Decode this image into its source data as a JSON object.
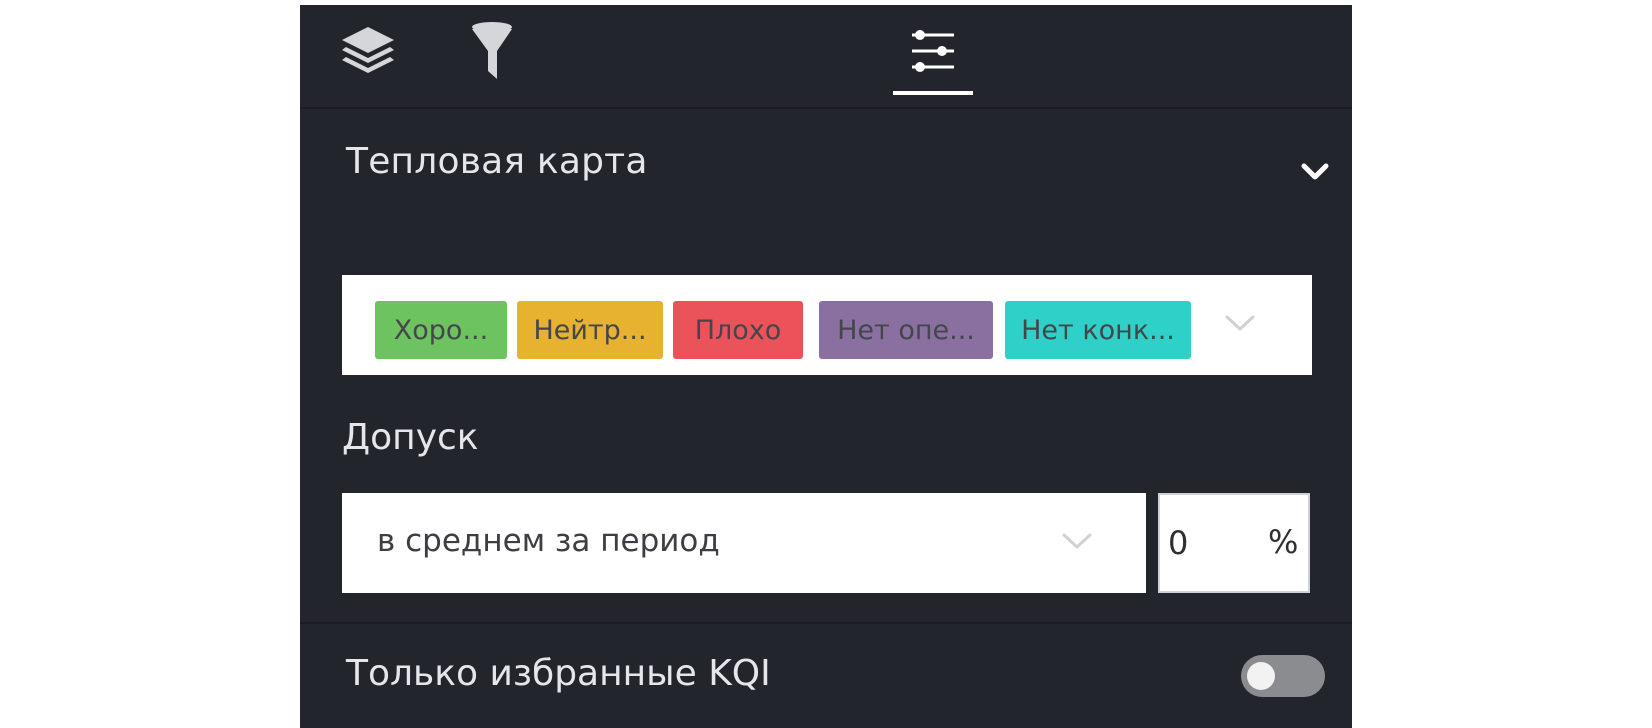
{
  "tabs": [
    {
      "icon": "layers-icon"
    },
    {
      "icon": "filter-icon"
    },
    {
      "icon": "sliders-icon",
      "active": true
    }
  ],
  "heatmap": {
    "title": "Тепловая карта",
    "chips": [
      {
        "label": "Хоро...",
        "color": "#6cc35f"
      },
      {
        "label": "Нейтр...",
        "color": "#e7b22f"
      },
      {
        "label": "Плохо",
        "color": "#ec5259"
      },
      {
        "label": "Нет опе...",
        "color": "#8a70a0"
      },
      {
        "label": "Нет конк...",
        "color": "#2fd0c8"
      }
    ]
  },
  "tolerance": {
    "label": "Допуск",
    "mode": "в среднем за период",
    "value": "0",
    "unit": "%"
  },
  "favorites": {
    "label": "Только избранные KQI",
    "enabled": false
  },
  "colors": {
    "panel_bg": "#22252b",
    "text": "#e4e6ea",
    "active_tab_underline": "#ffffff",
    "toggle_off": "#8a8c90"
  }
}
